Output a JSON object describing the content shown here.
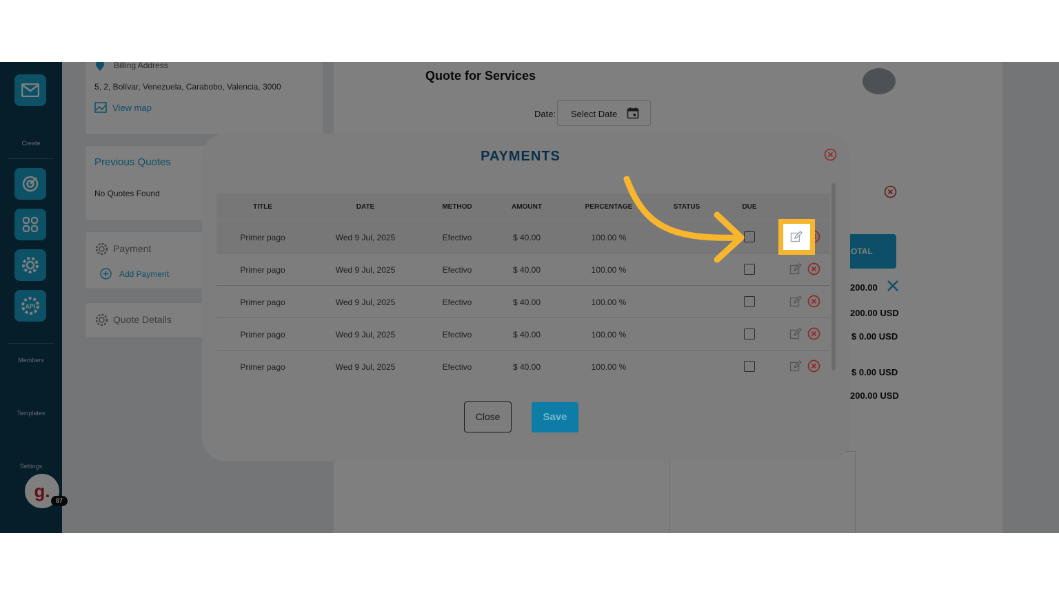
{
  "sidebar": {
    "labels": {
      "create": "Create",
      "members": "Members",
      "templates": "Templates",
      "settings": "Settings"
    },
    "icons": [
      "mail-icon",
      "target-icon",
      "grid-icon",
      "gear-icon",
      "api-icon"
    ],
    "api_label": "API",
    "avatar_letter": "g.",
    "avatar_badge": "87"
  },
  "client": {
    "billing_address_label": "Billing Address",
    "address": "5, 2, Bolívar, Venezuela, Carabobo, Valencia, 3000",
    "view_map": "View map",
    "previous_quotes_title": "Previous Quotes",
    "no_quotes": "No Quotes Found",
    "payment_title": "Payment",
    "add_payment": "Add Payment",
    "quote_details": "Quote Details"
  },
  "document": {
    "title": "Quote for Services",
    "date_label": "Date:",
    "date_placeholder": "Select Date",
    "total_header": "OTAL",
    "totals": [
      "200.00",
      "200.00 USD",
      "$ 0.00 USD",
      "$ 0.00 USD",
      "200.00 USD"
    ]
  },
  "modal": {
    "title": "PAYMENTS",
    "columns": [
      "TITLE",
      "DATE",
      "METHOD",
      "AMOUNT",
      "PERCENTAGE",
      "STATUS",
      "DUE"
    ],
    "rows": [
      {
        "title": "Primer pago",
        "date": "Wed 9 Jul, 2025",
        "method": "Efectivo",
        "amount": "$ 40.00",
        "percentage": "100.00 %",
        "status": ""
      },
      {
        "title": "Primer pago",
        "date": "Wed 9 Jul, 2025",
        "method": "Efectivo",
        "amount": "$ 40.00",
        "percentage": "100.00 %",
        "status": ""
      },
      {
        "title": "Primer pago",
        "date": "Wed 9 Jul, 2025",
        "method": "Efectivo",
        "amount": "$ 40.00",
        "percentage": "100.00 %",
        "status": ""
      },
      {
        "title": "Primer pago",
        "date": "Wed 9 Jul, 2025",
        "method": "Efectivo",
        "amount": "$ 40.00",
        "percentage": "100.00 %",
        "status": ""
      },
      {
        "title": "Primer pago",
        "date": "Wed 9 Jul, 2025",
        "method": "Efectivo",
        "amount": "$ 40.00",
        "percentage": "100.00 %",
        "status": ""
      }
    ],
    "close_label": "Close",
    "save_label": "Save"
  },
  "colors": {
    "accent": "#1a9dd0",
    "sidebar": "#0d3b55",
    "highlight": "#f8b62f",
    "danger": "#c0392b"
  }
}
